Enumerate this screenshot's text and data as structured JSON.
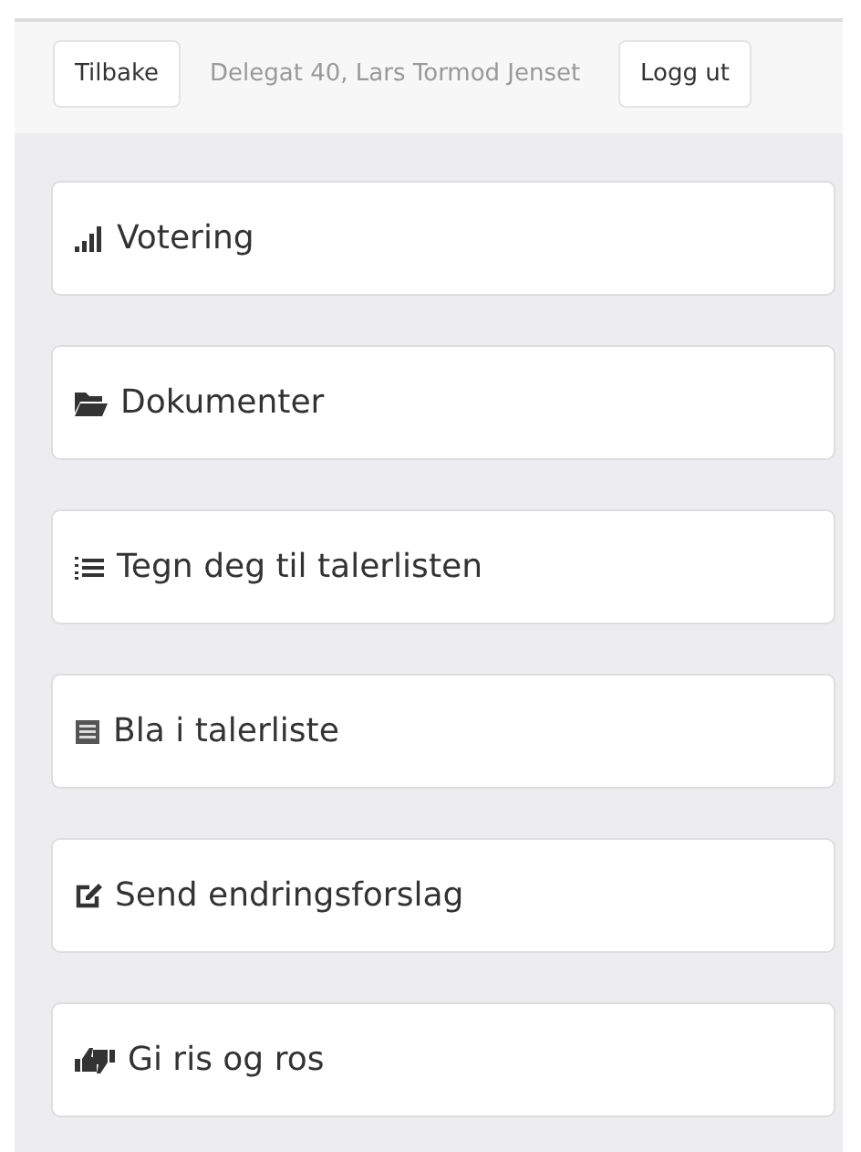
{
  "header": {
    "back_button": "Tilbake",
    "user_label": "Delegat 40, Lars Tormod Jenset",
    "logout_button": "Logg ut"
  },
  "menu": [
    {
      "kind": "voting",
      "label": "Votering"
    },
    {
      "kind": "documents",
      "label": "Dokumenter"
    },
    {
      "kind": "signup",
      "label": "Tegn deg til talerlisten"
    },
    {
      "kind": "list",
      "label": "Bla i talerliste"
    },
    {
      "kind": "edit",
      "label": "Send endringsforslag"
    },
    {
      "kind": "feedback",
      "label": "Gi ris og ros"
    }
  ]
}
